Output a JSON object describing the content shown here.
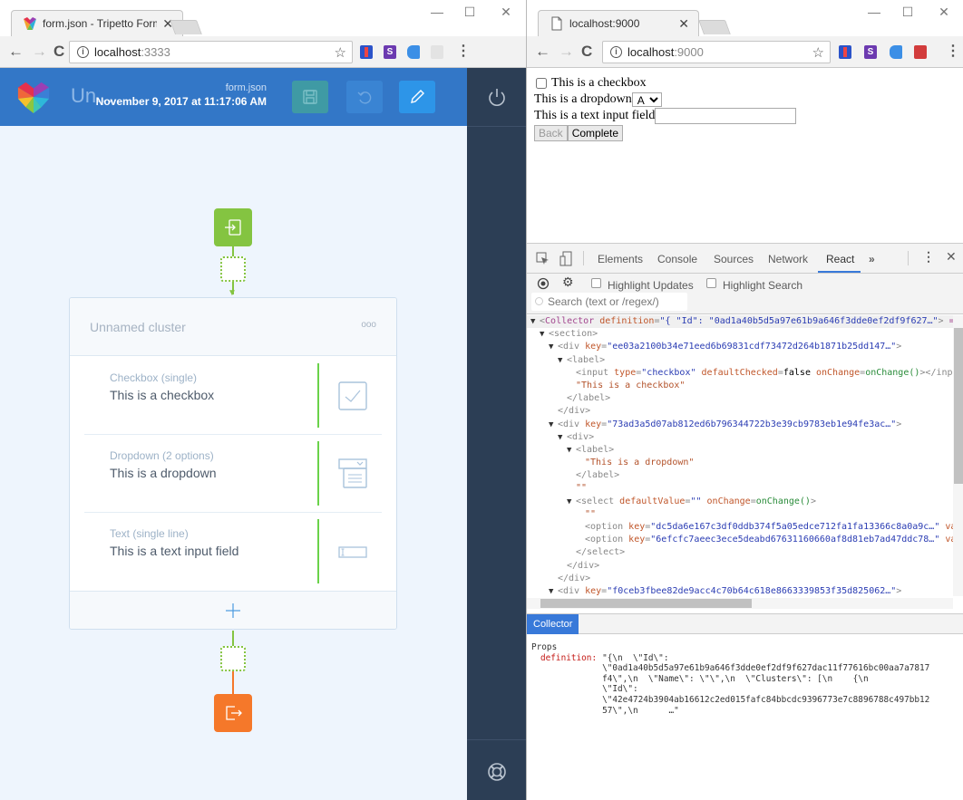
{
  "left_window": {
    "tab_title": "form.json - Tripetto Form",
    "tab_close": "✕",
    "window_controls": {
      "minimize": "—",
      "maximize": "☐",
      "close": "✕"
    },
    "url_host": "localhost",
    "url_port": ":3333",
    "app": {
      "title": "Un...",
      "file_name": "form.json",
      "file_date": "November 9, 2017 at 11:17:06 AM",
      "buttons": [
        "save-icon",
        "undo-icon",
        "edit-pencil-icon"
      ],
      "sidebar_icons": [
        "power-icon",
        "help-lifebuoy-icon"
      ],
      "cluster": {
        "name": "Unnamed cluster",
        "more": "ooo",
        "blocks": [
          {
            "type": "Checkbox (single)",
            "name": "This is a checkbox",
            "icon": "checkbox-icon"
          },
          {
            "type": "Dropdown (2 options)",
            "name": "This is a dropdown",
            "icon": "dropdown-icon"
          },
          {
            "type": "Text (single line)",
            "name": "This is a text input field",
            "icon": "text-input-icon"
          }
        ],
        "add_label": "+"
      },
      "colors": {
        "header": "#3377c7",
        "sidebar": "#2c3e55",
        "start": "#84c441",
        "end": "#f5782a",
        "branch": "#6ad24a"
      }
    }
  },
  "right_window": {
    "tab_title": "localhost:9000",
    "tab_close": "✕",
    "window_controls": {
      "minimize": "—",
      "maximize": "☐",
      "close": "✕"
    },
    "url_host": "localhost",
    "url_port": ":9000",
    "form": {
      "checkbox_label": "This is a checkbox",
      "checkbox_checked": false,
      "dropdown_label": "This is a dropdown",
      "dropdown_value": "A",
      "text_label": "This is a text input field",
      "text_value": "",
      "back_label": "Back",
      "complete_label": "Complete"
    },
    "devtools": {
      "tabs": [
        "Elements",
        "Console",
        "Sources",
        "Network",
        "React"
      ],
      "active_tab": "React",
      "more_tabs": "»",
      "highlight_updates": "Highlight Updates",
      "highlight_search": "Highlight Search",
      "search_placeholder": "Search (text or /regex/)",
      "tree": {
        "root_tag": "Collector",
        "root_attr": "definition",
        "root_value": "\"{ \"Id\": \"0ad1a40b5d5a97e61b9a646f3dde0ef2df9f627…\"",
        "div1_key": "\"ee03a2100b34e71eed6b69831cdf73472d264b1871b25dd147…\"",
        "checkbox_string": "\"This is a checkbox\"",
        "div2_key": "\"73ad3a5d07ab812ed6b796344722b3e39cb9783eb1e94fe3ac…\"",
        "dropdown_string": "\"This is a dropdown\"",
        "empty_string": "\"\"",
        "option1_key": "\"dc5da6e167c3df0ddb374f5a05edce712fa1fa13366c8a0a9c…\"",
        "option2_key": "\"6efcfc7aeec3ece5deabd67631160660af8d81eb7ad47ddc78…\"",
        "div3_key": "\"f0ceb3fbee82de9acc4c70b64c618e8663339853f35d825062…\""
      },
      "panel_tab": "Collector",
      "props_title": "Props",
      "props_key": "definition:",
      "props_value_lines": [
        "\"{\\n  \\\"Id\\\":",
        "\\\"0ad1a40b5d5a97e61b9a646f3dde0ef2df9f627dac11f77616bc00aa7a7817",
        "f4\\\",\\n  \\\"Name\\\": \\\"\\\",\\n  \\\"Clusters\\\": [\\n    {\\n",
        "\\\"Id\\\":",
        "\\\"42e4724b3904ab16612c2ed015fafc84bbcdc9396773e7c8896788c497bb12",
        "57\\\",\\n      …\""
      ]
    }
  }
}
